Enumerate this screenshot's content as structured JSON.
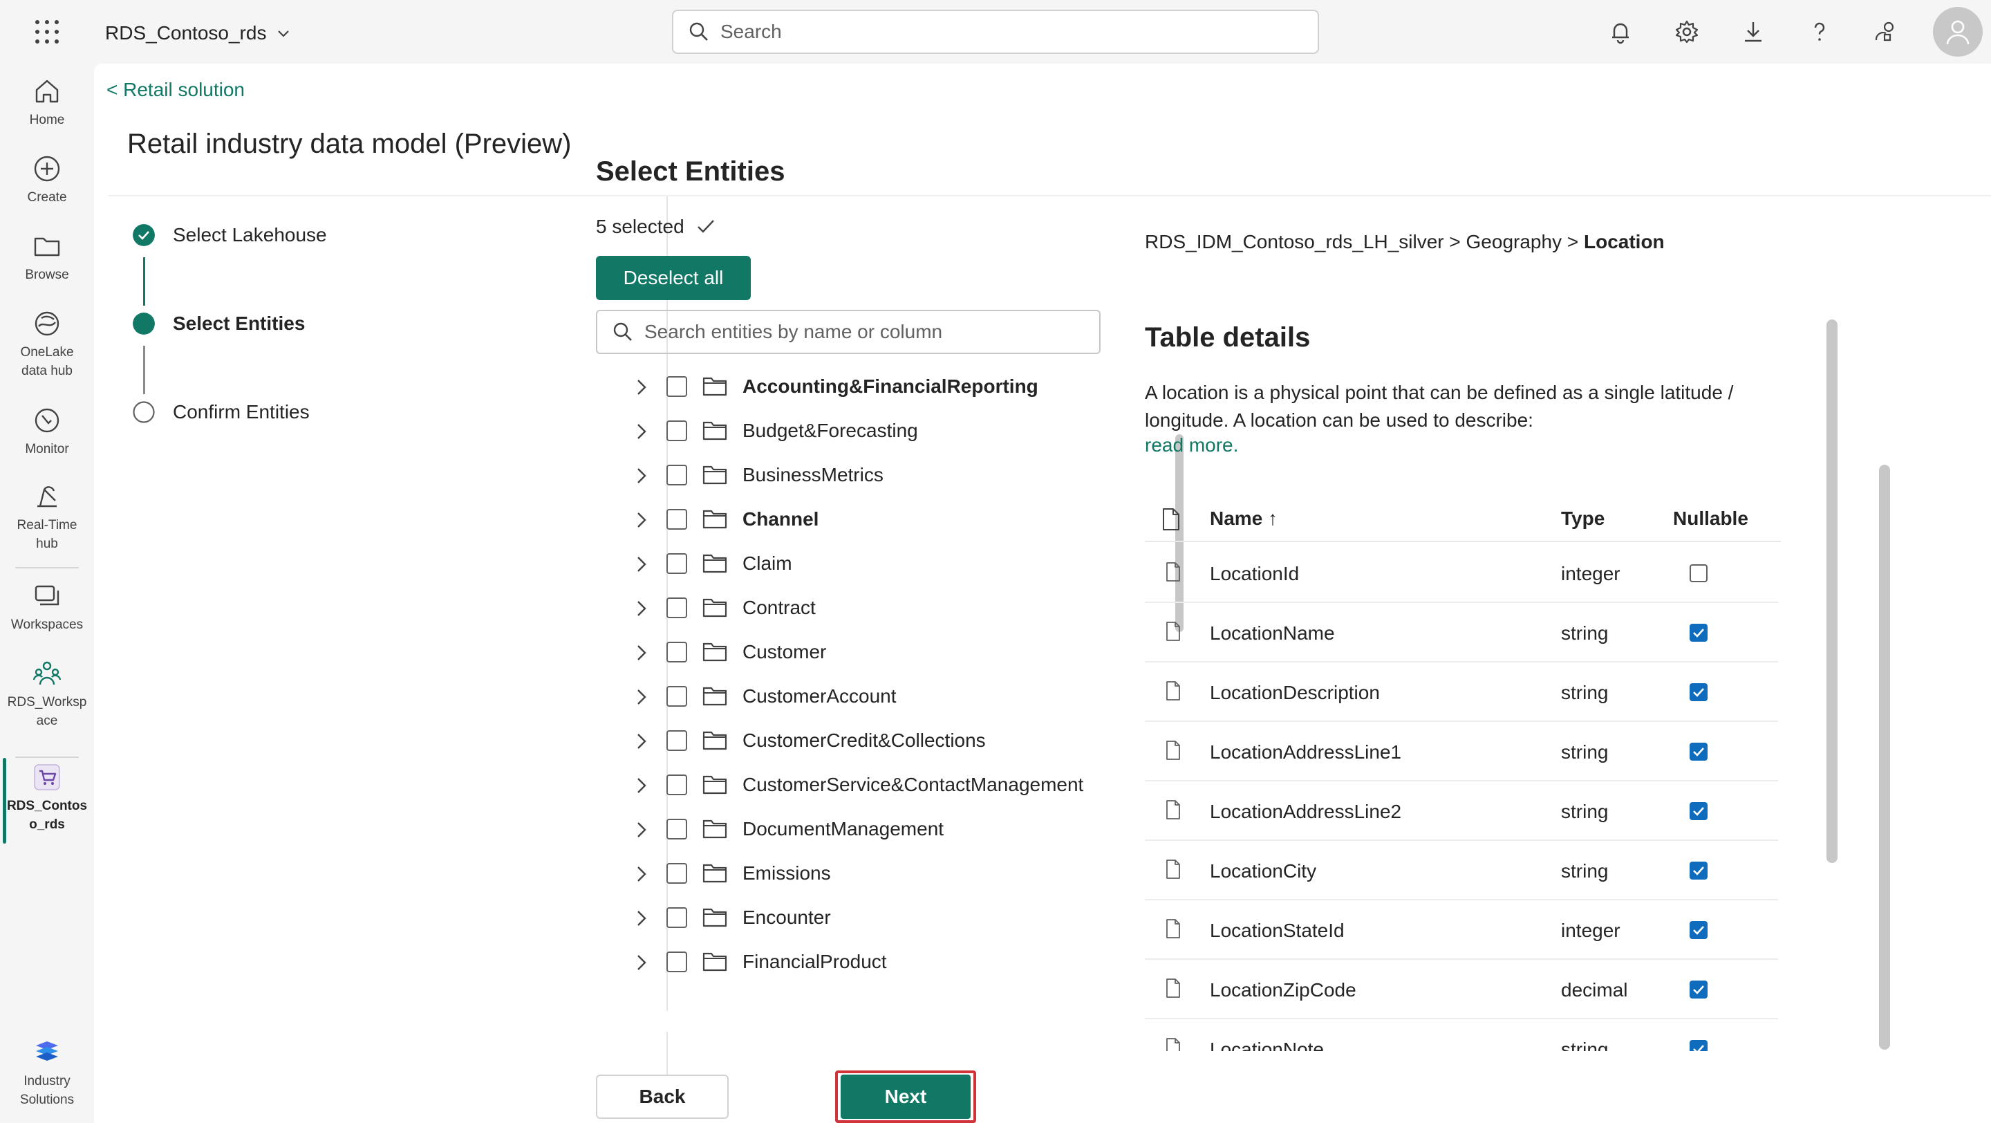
{
  "topbar": {
    "workspace_name": "RDS_Contoso_rds",
    "search_placeholder": "Search"
  },
  "rail": [
    {
      "label": "Home",
      "icon": "home-icon"
    },
    {
      "label": "Create",
      "icon": "plus-circle-icon"
    },
    {
      "label": "Browse",
      "icon": "folder-icon"
    },
    {
      "label": "OneLake\ndata hub",
      "icon": "onelake-icon"
    },
    {
      "label": "Monitor",
      "icon": "monitor-icon"
    },
    {
      "label": "Real-Time\nhub",
      "icon": "realtime-icon"
    },
    {
      "label": "Workspaces",
      "icon": "workspaces-icon"
    },
    {
      "label": "RDS_Worksp\nace",
      "icon": "workspace-people-icon"
    },
    {
      "label": "RDS_Contos\no_rds",
      "icon": "cart-icon"
    },
    {
      "label": "Industry\nSolutions",
      "icon": "industry-solutions-icon"
    }
  ],
  "header": {
    "back_link": "< Retail solution",
    "title": "Retail industry data model (Preview)"
  },
  "steps": [
    {
      "label": "Select Lakehouse",
      "state": "done"
    },
    {
      "label": "Select Entities",
      "state": "current"
    },
    {
      "label": "Confirm Entities",
      "state": "pending"
    }
  ],
  "entities": {
    "title": "Select Entities",
    "selected_count": "5 selected",
    "deselect_label": "Deselect all",
    "search_placeholder": "Search entities by name or column",
    "items": [
      {
        "name": "Accounting&FinancialReporting",
        "bold": true
      },
      {
        "name": "Budget&Forecasting",
        "bold": false
      },
      {
        "name": "BusinessMetrics",
        "bold": false
      },
      {
        "name": "Channel",
        "bold": true
      },
      {
        "name": "Claim",
        "bold": false
      },
      {
        "name": "Contract",
        "bold": false
      },
      {
        "name": "Customer",
        "bold": false
      },
      {
        "name": "CustomerAccount",
        "bold": false
      },
      {
        "name": "CustomerCredit&Collections",
        "bold": false
      },
      {
        "name": "CustomerService&ContactManagement",
        "bold": false
      },
      {
        "name": "DocumentManagement",
        "bold": false
      },
      {
        "name": "Emissions",
        "bold": false
      },
      {
        "name": "Encounter",
        "bold": false
      },
      {
        "name": "FinancialProduct",
        "bold": false
      }
    ]
  },
  "details": {
    "crumb_path": "RDS_IDM_Contoso_rds_LH_silver > Geography > ",
    "crumb_current": "Location",
    "title": "Table details",
    "description": "A location is a physical point that can be defined as a single latitude / longitude. A location can be used to describe:",
    "read_more": "read more.",
    "columns": {
      "name": "Name ↑",
      "type": "Type",
      "nullable": "Nullable"
    },
    "rows": [
      {
        "name": "LocationId",
        "type": "integer",
        "nullable": false
      },
      {
        "name": "LocationName",
        "type": "string",
        "nullable": true
      },
      {
        "name": "LocationDescription",
        "type": "string",
        "nullable": true
      },
      {
        "name": "LocationAddressLine1",
        "type": "string",
        "nullable": true
      },
      {
        "name": "LocationAddressLine2",
        "type": "string",
        "nullable": true
      },
      {
        "name": "LocationCity",
        "type": "string",
        "nullable": true
      },
      {
        "name": "LocationStateId",
        "type": "integer",
        "nullable": true
      },
      {
        "name": "LocationZipCode",
        "type": "decimal",
        "nullable": true
      },
      {
        "name": "LocationNote",
        "type": "string",
        "nullable": true
      }
    ]
  },
  "footer": {
    "back_label": "Back",
    "next_label": "Next"
  },
  "colors": {
    "accent": "#117865",
    "checkbox": "#0f6cbd",
    "highlight": "#d13438"
  }
}
